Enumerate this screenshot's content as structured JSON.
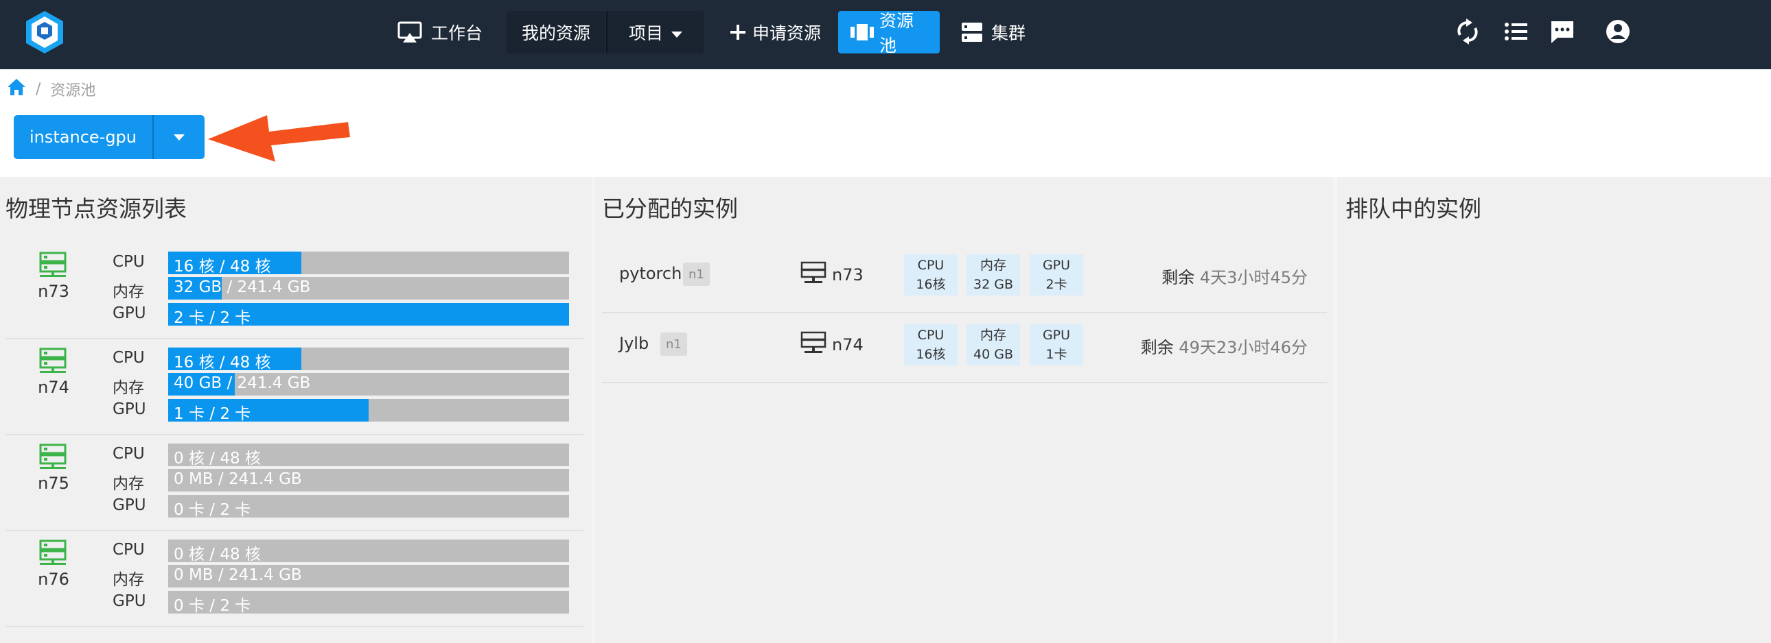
{
  "nav": {
    "items": [
      {
        "label": "工作台",
        "icon": "airplay-icon"
      },
      {
        "label": "我的资源"
      },
      {
        "label": "项目",
        "icon": "caret-down-icon"
      },
      {
        "label": "申请资源",
        "icon": "plus-icon"
      },
      {
        "label": "资源池",
        "icon": "pool-icon",
        "active": true
      },
      {
        "label": "集群",
        "icon": "server-icon"
      }
    ],
    "right_icons": [
      "refresh-icon",
      "list-icon",
      "message-icon",
      "account-icon"
    ],
    "colors": {
      "bg": "#1f2a38",
      "active": "#1296f0"
    }
  },
  "breadcrumb": {
    "home_icon": "home-icon",
    "separator": "/",
    "current": "资源池"
  },
  "pool_selector": {
    "label": "instance-gpu"
  },
  "nodes_panel": {
    "title": "物理节点资源列表",
    "nodes": [
      {
        "name": "n73",
        "resources": [
          {
            "label": "CPU",
            "text": "16 核 / 48 核",
            "fraction": 0.333
          },
          {
            "label": "内存",
            "text": "32 GB / 241.4 GB",
            "fraction": 0.133
          },
          {
            "label": "GPU",
            "text": "2 卡 / 2 卡",
            "fraction": 1.0
          }
        ]
      },
      {
        "name": "n74",
        "resources": [
          {
            "label": "CPU",
            "text": "16 核 / 48 核",
            "fraction": 0.333
          },
          {
            "label": "内存",
            "text": "40 GB / 241.4 GB",
            "fraction": 0.166
          },
          {
            "label": "GPU",
            "text": "1 卡 / 2 卡",
            "fraction": 0.5
          }
        ]
      },
      {
        "name": "n75",
        "resources": [
          {
            "label": "CPU",
            "text": "0 核 / 48 核",
            "fraction": 0
          },
          {
            "label": "内存",
            "text": "0 MB / 241.4 GB",
            "fraction": 0
          },
          {
            "label": "GPU",
            "text": "0 卡 / 2 卡",
            "fraction": 0
          }
        ]
      },
      {
        "name": "n76",
        "resources": [
          {
            "label": "CPU",
            "text": "0 核 / 48 核",
            "fraction": 0
          },
          {
            "label": "内存",
            "text": "0 MB / 241.4 GB",
            "fraction": 0
          },
          {
            "label": "GPU",
            "text": "0 卡 / 2 卡",
            "fraction": 0
          }
        ]
      }
    ]
  },
  "allocated_panel": {
    "title": "已分配的实例",
    "instances": [
      {
        "name": "pytorch",
        "badge": "n1",
        "node": "n73",
        "chips": [
          {
            "label": "CPU",
            "value": "16核"
          },
          {
            "label": "内存",
            "value": "32 GB"
          },
          {
            "label": "GPU",
            "value": "2卡"
          }
        ],
        "remain_label": "剩余",
        "remain_value": "4天3小时45分"
      },
      {
        "name": "Jylb",
        "badge": "n1",
        "node": "n74",
        "chips": [
          {
            "label": "CPU",
            "value": "16核"
          },
          {
            "label": "内存",
            "value": "40 GB"
          },
          {
            "label": "GPU",
            "value": "1卡"
          }
        ],
        "remain_label": "剩余",
        "remain_value": "49天23小时46分"
      }
    ]
  },
  "queued_panel": {
    "title": "排队中的实例"
  }
}
